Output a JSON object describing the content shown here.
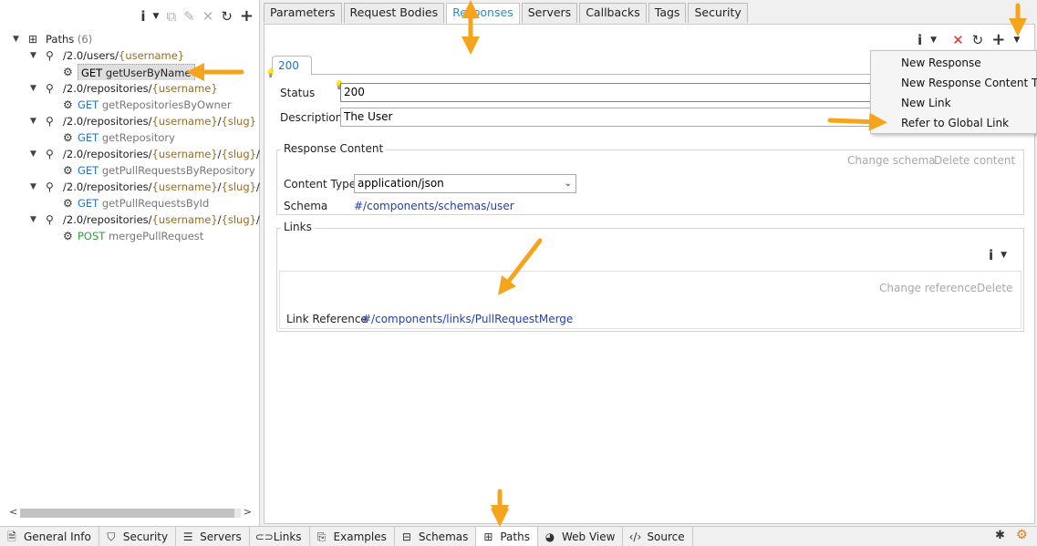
{
  "left_toolbar": {
    "icons": [
      "info-icon",
      "dropdown-icon",
      "copy-icon",
      "edit-icon",
      "delete-icon",
      "refresh-icon",
      "add-icon"
    ]
  },
  "tree": {
    "root_label": "Paths",
    "root_count": "(6)",
    "paths": [
      {
        "prefix": "/2.0/users/",
        "v1": "{username}",
        "mid": "",
        "v2": "",
        "suffix": "",
        "method": "GET",
        "op": "getUserByName",
        "method_color": "#000000"
      },
      {
        "prefix": "/2.0/repositories/",
        "v1": "{username}",
        "mid": "",
        "v2": "",
        "suffix": "",
        "method": "GET",
        "op": "getRepositoriesByOwner",
        "method_color": "#1f74c9"
      },
      {
        "prefix": "/2.0/repositories/",
        "v1": "{username}",
        "mid": "/",
        "v2": "{slug}",
        "suffix": "",
        "method": "GET",
        "op": "getRepository",
        "method_color": "#1f74c9"
      },
      {
        "prefix": "/2.0/repositories/",
        "v1": "{username}",
        "mid": "/",
        "v2": "{slug}",
        "suffix": "/pull",
        "method": "GET",
        "op": "getPullRequestsByRepository",
        "method_color": "#1f74c9"
      },
      {
        "prefix": "/2.0/repositories/",
        "v1": "{username}",
        "mid": "/",
        "v2": "{slug}",
        "suffix": "/pull",
        "method": "GET",
        "op": "getPullRequestsById",
        "method_color": "#1f74c9"
      },
      {
        "prefix": "/2.0/repositories/",
        "v1": "{username}",
        "mid": "/",
        "v2": "{slug}",
        "suffix": "/pull",
        "method": "POST",
        "op": "mergePullRequest",
        "method_color": "#2f9c3a"
      }
    ]
  },
  "tabs": [
    "Parameters",
    "Request Bodies",
    "Responses",
    "Servers",
    "Callbacks",
    "Tags",
    "Security"
  ],
  "active_tab": "Responses",
  "response": {
    "code": "200",
    "status_label": "Status",
    "status_value": "200",
    "description_label": "Description",
    "description_value": "The User"
  },
  "response_content": {
    "title": "Response Content",
    "change_schema": "Change schema",
    "delete_content": "Delete content",
    "content_type_label": "Content Type",
    "content_type_value": "application/json",
    "schema_label": "Schema",
    "schema_value": "#/components/schemas/user"
  },
  "links": {
    "title": "Links",
    "change_reference": "Change reference",
    "delete": "Delete",
    "link_reference_label": "Link Reference",
    "link_reference_value": "#/components/links/PullRequestMerge"
  },
  "context_menu": {
    "items": [
      "New Response",
      "New Response Content Type",
      "New Link",
      "Refer to Global Link"
    ]
  },
  "bottom_tabs": [
    {
      "label": "General Info",
      "icon": "document-icon"
    },
    {
      "label": "Security",
      "icon": "shield-icon"
    },
    {
      "label": "Servers",
      "icon": "server-icon"
    },
    {
      "label": "Links",
      "icon": "link-icon"
    },
    {
      "label": "Examples",
      "icon": "examples-icon"
    },
    {
      "label": "Schemas",
      "icon": "schemas-icon"
    },
    {
      "label": "Paths",
      "icon": "paths-icon"
    },
    {
      "label": "Web View",
      "icon": "globe-icon"
    },
    {
      "label": "Source",
      "icon": "code-icon"
    }
  ],
  "active_bottom_tab": "Paths",
  "colors": {
    "accent": "#1f8fd6",
    "variable": "#9a6a1e",
    "link": "#1e3fb8",
    "arrow": "#f5a41c",
    "delete": "#e0302a"
  }
}
